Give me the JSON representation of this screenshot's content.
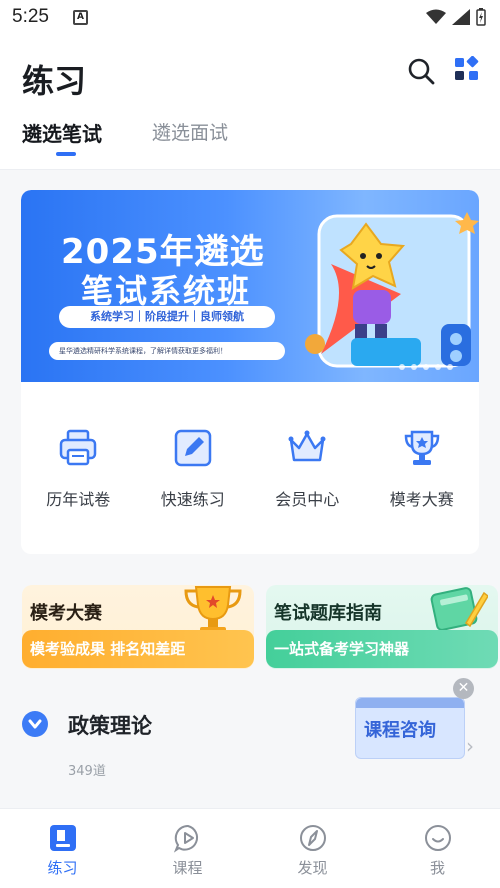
{
  "status_bar": {
    "time": "5:25",
    "notification_icon": "a-icon"
  },
  "header": {
    "title": "练习",
    "tabs": [
      {
        "label": "遴选笔试",
        "active": true
      },
      {
        "label": "遴选面试",
        "active": false
      }
    ],
    "accent_color": "#2f6ff5"
  },
  "banner": {
    "title_line1": "2025年遴选",
    "title_line2": "笔试系统班",
    "tagline": "系统学习｜阶段提升｜良师领航",
    "note": "星华遴选精研科学系统课程，了解详情获取更多福利！"
  },
  "quick_links": [
    {
      "label": "历年试卷",
      "icon": "printer-icon"
    },
    {
      "label": "快速练习",
      "icon": "edit-icon"
    },
    {
      "label": "会员中心",
      "icon": "crown-icon"
    },
    {
      "label": "模考大赛",
      "icon": "trophy-icon"
    }
  ],
  "promos": [
    {
      "title": "模考大赛",
      "subtitle": "模考验成果 排名知差距",
      "color": "#ffb234"
    },
    {
      "title": "笔试题库指南",
      "subtitle": "一站式备考学习神器",
      "color": "#48d09d"
    }
  ],
  "section": {
    "title": "政策理论",
    "count": "349道"
  },
  "consult": {
    "label": "课程咨询"
  },
  "bottom_nav": [
    {
      "label": "练习",
      "icon": "practice-icon",
      "active": true
    },
    {
      "label": "课程",
      "icon": "play-icon",
      "active": false
    },
    {
      "label": "发现",
      "icon": "compass-icon",
      "active": false
    },
    {
      "label": "我",
      "icon": "smile-icon",
      "active": false
    }
  ]
}
